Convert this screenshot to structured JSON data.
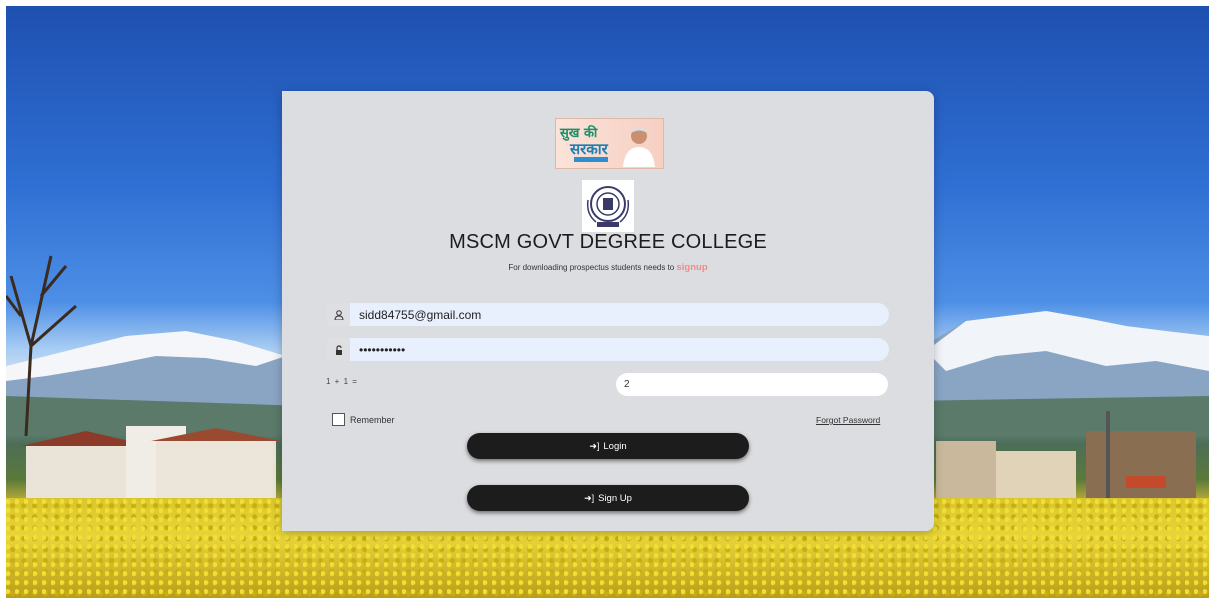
{
  "banner": {
    "line1": "सुख की",
    "line2": "सरकार"
  },
  "college": {
    "name": "MSCM GOVT DEGREE COLLEGE",
    "note_prefix": "For downloading prospectus students needs to",
    "note_link": "signup"
  },
  "form": {
    "email_value": "sidd84755@gmail.com",
    "password_value": "•••••••••••",
    "email_icon": "user-icon",
    "password_icon": "lock-icon",
    "captcha_question": "1 + 1 =",
    "captcha_value": "2",
    "remember_label": "Remember",
    "remember_checked": false,
    "forgot_label": "Forgot Password",
    "login_label": "Login",
    "signup_label": "Sign Up",
    "login_icon": "sign-in-icon"
  },
  "colors": {
    "card": "#dcdde0",
    "button": "#1c1c1c",
    "signup_link": "#f08a8a",
    "input_bg": "#e8f0fe"
  }
}
